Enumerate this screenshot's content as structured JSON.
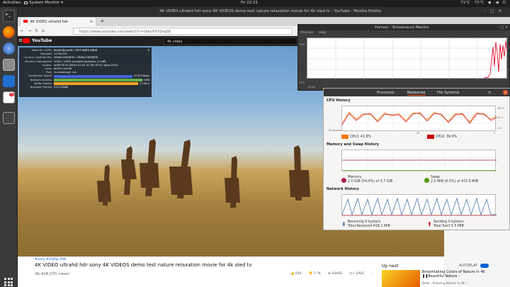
{
  "topbar": {
    "activities": "Activities",
    "app_name": "System Monitor",
    "clock": "Fri 22:21",
    "temp1": "71°C",
    "temp2": "71°C"
  },
  "dock": {
    "badge": "71"
  },
  "firefox": {
    "window_title": "4K VIDEO ultrahd hdr sony 4K VIDEOS demo test nature relaxation movie for 4k oled tv - YouTube - Mozilla Firefox",
    "tab_label": "4K VIDEO ultrahd hdr",
    "url": "https://www.youtube.com/watch?v=c8eyHXX2kqS8"
  },
  "youtube": {
    "logo": "YouTube",
    "search_value": "4k video",
    "hashtags": "#sony #2160p #4k",
    "video_title": "4K VIDEO ultrahd hdr sony 4K VIDEOS demo test nature relaxation movie for 4k oled tv",
    "views": "46,428,070 views",
    "likes": "64K",
    "dislikes": "7.7K",
    "share": "SHARE",
    "save": "SAVE",
    "up_next": "Up next",
    "autoplay": "AUTOPLAY",
    "next_title": "Breathtaking Colors of Nature in 4K ❚❚Beautiful Nature -",
    "next_sub": "Bella - Relaxing Nature in 4K ✓",
    "watermark": "©"
  },
  "stats": {
    "rows": [
      {
        "k": "Video ID / sCPN",
        "v": "8eo4XXJrkq58 / 3ZYF 8NR0 8BHB"
      },
      {
        "k": "Viewport",
        "v": "1274x715"
      },
      {
        "k": "Current / Optimal Res",
        "v": "3840x2160@30 / 3840x2160@30"
      },
      {
        "k": "Volume / Normalized",
        "v": "100% / 100% (content loudness -0.1dB)"
      },
      {
        "k": "Codecs",
        "v": "vp09.00.51.08.01.01.01.01.00 (313) / opus (251)"
      },
      {
        "k": "Color",
        "v": "bt709 / bt709"
      },
      {
        "k": "Pixel",
        "v": "1s-erase.ug1 nco"
      }
    ],
    "connection_label": "Connection Speed",
    "connection_value": "47125 Kbps",
    "network_label": "Network Activity",
    "network_value": "0 KB",
    "buffer_label": "Buffer Health",
    "buffer_value": "17.80 s",
    "dropped_label": "Dropped Frames",
    "dropped_value": "2217/3466",
    "colors": {
      "connection": "#3f66d9",
      "buffer": "#f6a41c",
      "network": "#6ab04c"
    }
  },
  "psensor": {
    "title": "Psensor - Temperature Monitor",
    "menu_prefs": "Psensor",
    "menu_help": "Help",
    "y_top": "73°C",
    "y_bottom": "37°C",
    "time_label": "22:02",
    "line_color": "#e0102a"
  },
  "sysmon": {
    "tabs": [
      "Processes",
      "Resources",
      "File Systems"
    ],
    "active_tab": "Resources",
    "cpu": {
      "title": "CPU History",
      "cpu1_label": "CPU1",
      "cpu1_value": "41.8%",
      "cpu2_label": "CPU2",
      "cpu2_value": "39.0%",
      "cpu1_color": "#f57900",
      "cpu2_color": "#cc0000",
      "y_labels": [
        "100 %",
        "50 %",
        "0 %"
      ],
      "x_start": "60 seconds",
      "x_mid": "30",
      "x_end": "0"
    },
    "memory": {
      "title": "Memory and Swap History",
      "mem_label": "Memory",
      "mem_value": "2.0 GiB (54.0%) of 3.7 GiB",
      "swap_label": "Swap",
      "swap_value": "2.2 MiB (0.5%) of 472.6 MiB",
      "mem_color": "#ad1d4f",
      "swap_color": "#4e9a06"
    },
    "network": {
      "title": "Network History",
      "recv_label": "Receiving",
      "recv_value": "0 bytes/s",
      "recv_total_label": "Total Received",
      "recv_total": "418.1 MiB",
      "send_label": "Sending",
      "send_value": "0 bytes/s",
      "send_total_label": "Total Sent",
      "send_total": "5.5 MiB",
      "recv_color": "#3465a4",
      "send_color": "#cc0000"
    }
  }
}
